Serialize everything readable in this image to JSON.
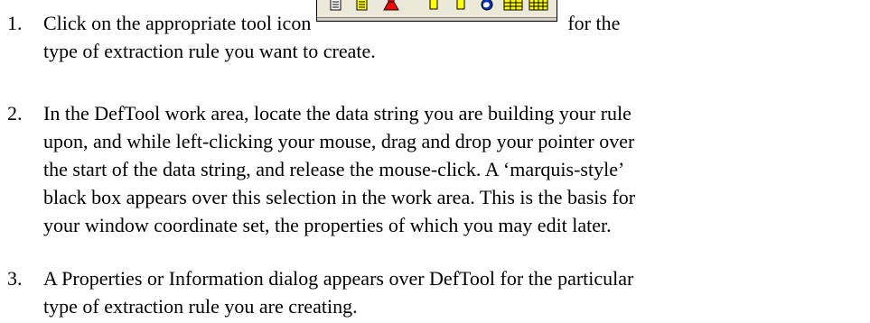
{
  "steps": [
    {
      "number": "1.",
      "before_toolbar": "Click on the appropriate tool icon",
      "after_toolbar": "for the",
      "rest": [
        "type of extraction rule you want to create."
      ]
    },
    {
      "number": "2.",
      "lines": [
        "In the DefTool work area, locate the data string you are building your rule",
        "upon, and while left-clicking your mouse, drag and drop your pointer over",
        "the start of the data string, and release the mouse-click. A ‘marquis-style’",
        "black box appears over this selection in the work area. This is the basis for",
        "your window coordinate set, the properties of which you may edit later."
      ]
    },
    {
      "number": "3.",
      "lines": [
        "A Properties or Information dialog appears over DefTool for the particular",
        "type of extraction rule you are creating."
      ]
    }
  ],
  "toolbar_icons": [
    "text-rule-icon",
    "highlight-rule-icon",
    "red-marker-icon",
    "yellow-flag-icon",
    "yellow-flag-icon",
    "globe-icon",
    "table-icon",
    "table-grid-icon"
  ],
  "colors": {
    "text": "#000000",
    "toolbar_face": "#ece9d8",
    "icon_yellow": "#ffff00",
    "icon_red": "#ff0000",
    "icon_blue": "#0033cc"
  }
}
